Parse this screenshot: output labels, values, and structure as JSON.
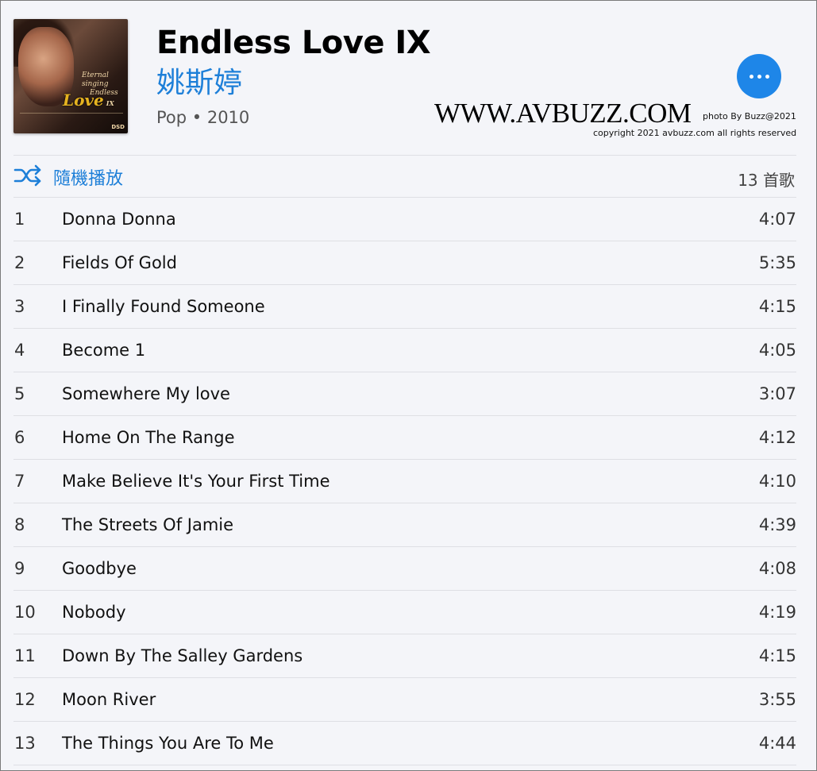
{
  "album": {
    "title": "Endless Love IX",
    "artist": "姚斯婷",
    "meta": "Pop • 2010",
    "cover_text": {
      "script": "Eternal singing",
      "endless": "Endless",
      "love": "Love",
      "roman": "IX",
      "dsd": "DSD"
    }
  },
  "actions": {
    "more_icon": "more-horizontal-icon",
    "shuffle_label": "隨機播放",
    "shuffle_icon": "shuffle-icon",
    "track_count": "13 首歌"
  },
  "watermark": {
    "site": "WWW.AVBUZZ.COM",
    "photo_by": "photo By Buzz@2021",
    "copyright": "copyright 2021 avbuzz.com all rights reserved"
  },
  "colors": {
    "accent": "#1d7fd8",
    "button": "#1e86e8",
    "background": "#f4f5f9",
    "divider": "#dedfe4"
  },
  "tracks": [
    {
      "num": "1",
      "name": "Donna Donna",
      "duration": "4:07"
    },
    {
      "num": "2",
      "name": "Fields Of Gold",
      "duration": "5:35"
    },
    {
      "num": "3",
      "name": "I Finally Found Someone",
      "duration": "4:15"
    },
    {
      "num": "4",
      "name": "Become 1",
      "duration": "4:05"
    },
    {
      "num": "5",
      "name": "Somewhere My love",
      "duration": "3:07"
    },
    {
      "num": "6",
      "name": "Home On The Range",
      "duration": "4:12"
    },
    {
      "num": "7",
      "name": "Make Believe It's Your First Time",
      "duration": "4:10"
    },
    {
      "num": "8",
      "name": "The Streets Of Jamie",
      "duration": "4:39"
    },
    {
      "num": "9",
      "name": "Goodbye",
      "duration": "4:08"
    },
    {
      "num": "10",
      "name": "Nobody",
      "duration": "4:19"
    },
    {
      "num": "11",
      "name": "Down By The Salley Gardens",
      "duration": "4:15"
    },
    {
      "num": "12",
      "name": "Moon River",
      "duration": "3:55"
    },
    {
      "num": "13",
      "name": "The Things You Are To Me",
      "duration": "4:44"
    }
  ]
}
